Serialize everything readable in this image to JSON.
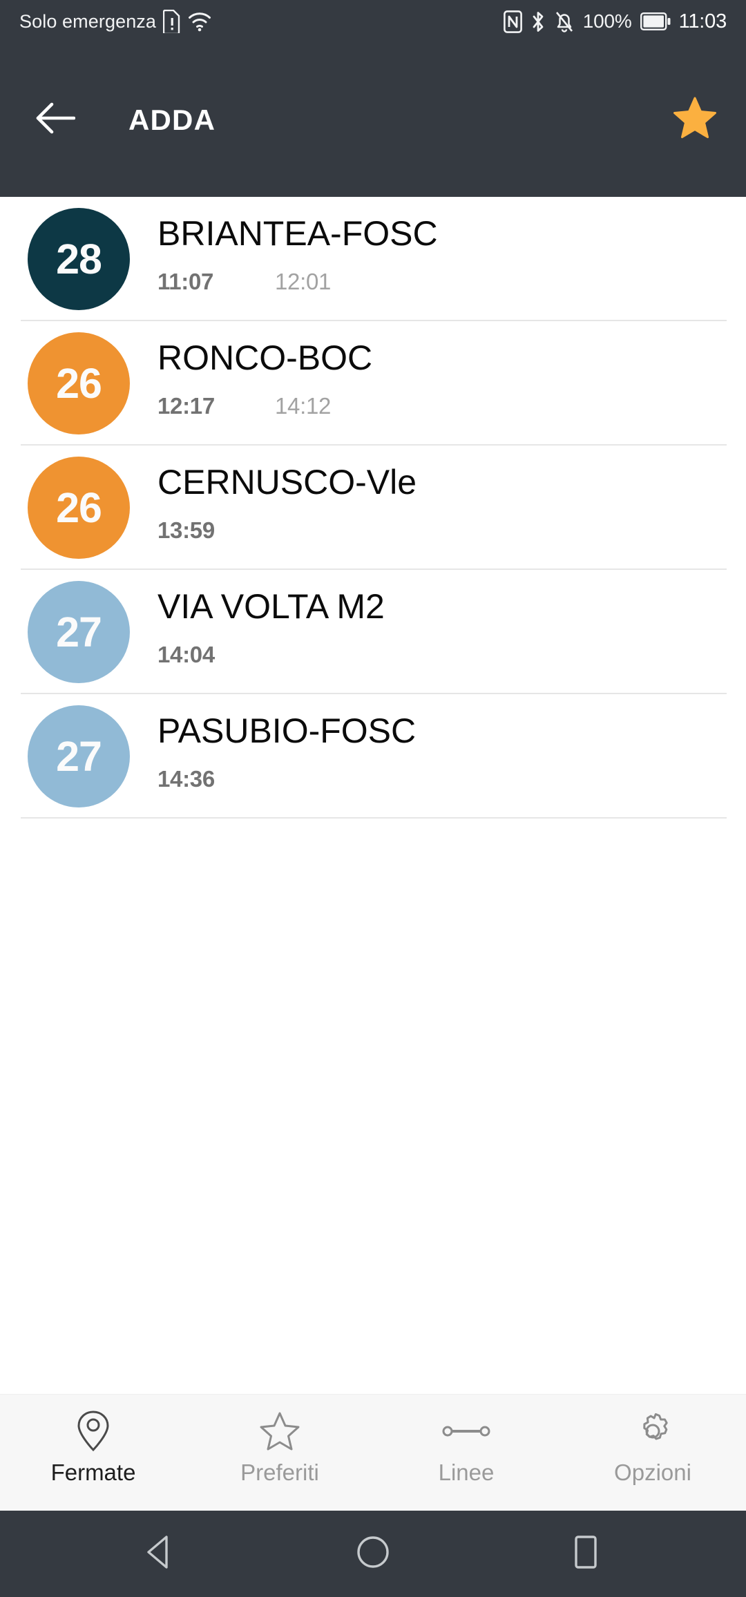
{
  "status_bar": {
    "carrier": "Solo emergenza",
    "sim_icon": "sim-alert-icon",
    "wifi_icon": "wifi-icon",
    "nfc_icon": "nfc-icon",
    "bluetooth_icon": "bluetooth-icon",
    "silent_icon": "bell-muted-icon",
    "battery_percent": "100%",
    "battery_icon": "battery-full-icon",
    "clock": "11:03",
    "background_color": "#353a41"
  },
  "app_bar": {
    "back_icon": "back-arrow-icon",
    "title": "ADDA",
    "favorite_icon": "star-filled-icon",
    "favorite_color": "#fbb040",
    "background_color": "#353a41"
  },
  "departures": [
    {
      "line": "28",
      "line_color": "#0d3845",
      "destination": "BRIANTEA-FOSC",
      "time_primary": "11:07",
      "time_secondary": "12:01"
    },
    {
      "line": "26",
      "line_color": "#ef9331",
      "destination": "RONCO-BOC",
      "time_primary": "12:17",
      "time_secondary": "14:12"
    },
    {
      "line": "26",
      "line_color": "#ef9331",
      "destination": "CERNUSCO-Vle",
      "time_primary": "13:59",
      "time_secondary": ""
    },
    {
      "line": "27",
      "line_color": "#91bad6",
      "destination": "VIA VOLTA M2",
      "time_primary": "14:04",
      "time_secondary": ""
    },
    {
      "line": "27",
      "line_color": "#91bad6",
      "destination": "PASUBIO-FOSC",
      "time_primary": "14:36",
      "time_secondary": ""
    }
  ],
  "bottom_nav": {
    "items": [
      {
        "label": "Fermate",
        "icon": "map-pin-icon",
        "active": true
      },
      {
        "label": "Preferiti",
        "icon": "star-outline-icon",
        "active": false
      },
      {
        "label": "Linee",
        "icon": "route-line-icon",
        "active": false
      },
      {
        "label": "Opzioni",
        "icon": "gear-icon",
        "active": false
      }
    ],
    "background_color": "#f7f7f7"
  },
  "android_nav": {
    "back": "android-back-icon",
    "home": "android-home-icon",
    "recents": "android-recents-icon",
    "background_color": "#353a41"
  }
}
